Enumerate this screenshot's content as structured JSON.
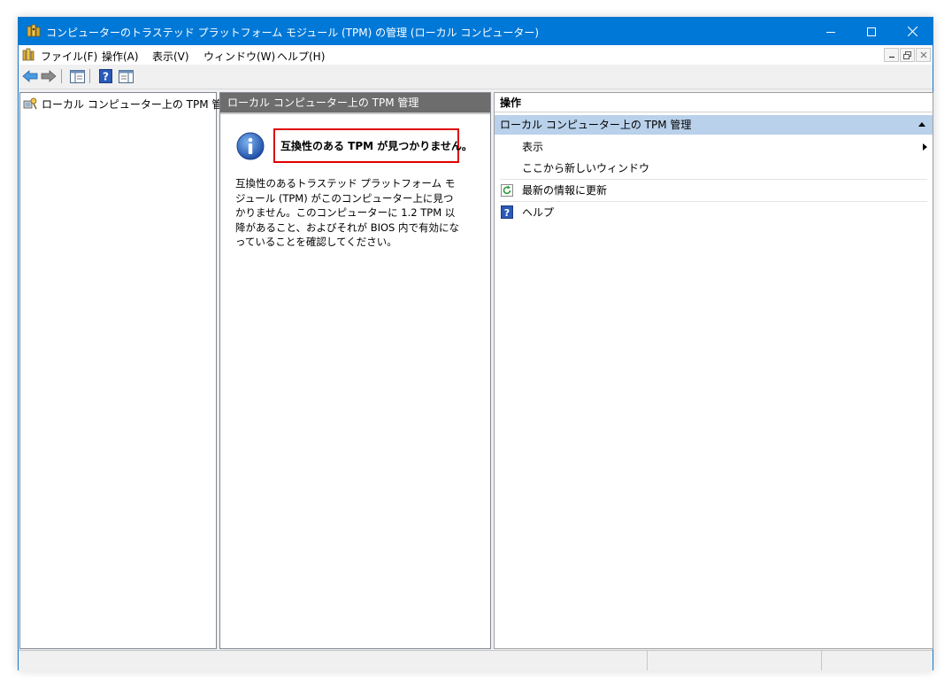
{
  "window": {
    "title": "コンピューターのトラステッド プラットフォーム モジュール (TPM) の管理 (ローカル コンピューター)",
    "colors": {
      "titlebar": "#0078d7",
      "selection": "#b9d1ea",
      "highlight_border": "#e00000"
    }
  },
  "menu": {
    "items": [
      "ファイル(F)",
      "操作(A)",
      "表示(V)",
      "ウィンドウ(W)",
      "ヘルプ(H)"
    ]
  },
  "toolbar": {
    "buttons": [
      "back-arrow-icon",
      "forward-arrow-icon",
      "show-hide-tree-icon",
      "help-icon",
      "show-hide-action-pane-icon"
    ]
  },
  "tree": {
    "root_label": "ローカル コンピューター上の TPM 管理"
  },
  "main": {
    "header": "ローカル コンピューター上の TPM 管理",
    "message_title": "互換性のある TPM が見つかりません。",
    "message_body": "互換性のあるトラステッド プラットフォーム モジュール (TPM) がこのコンピューター上に見つかりません。このコンピューターに 1.2 TPM 以降があること、およびそれが BIOS 内で有効になっていることを確認してください。"
  },
  "actions": {
    "header": "操作",
    "section_label": "ローカル コンピューター上の TPM 管理",
    "items": [
      {
        "label": "表示",
        "has_submenu": true
      },
      {
        "label": "ここから新しいウィンドウ"
      },
      {
        "label": "最新の情報に更新",
        "icon": "refresh-icon"
      },
      {
        "label": "ヘルプ",
        "icon": "help-icon"
      }
    ]
  }
}
